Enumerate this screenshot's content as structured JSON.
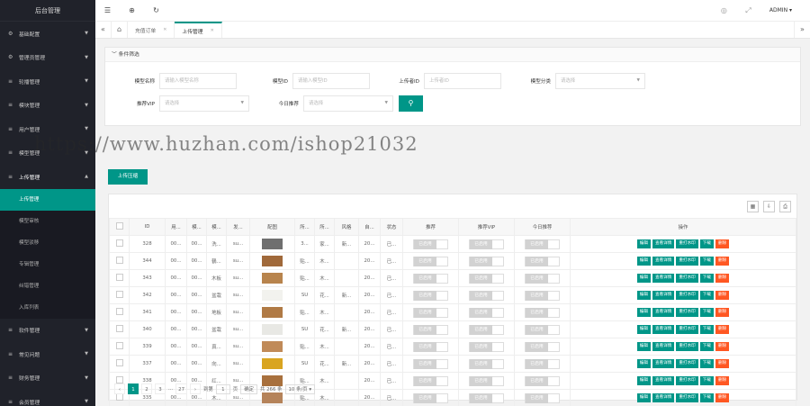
{
  "sidebar": {
    "logo": "后台管理",
    "items": [
      {
        "label": "基础配置",
        "icon": "gear-icon"
      },
      {
        "label": "管理员管理",
        "icon": "gear-icon"
      },
      {
        "label": "轮播管理",
        "icon": "menu-icon"
      },
      {
        "label": "模块管理",
        "icon": "menu-icon"
      },
      {
        "label": "用户管理",
        "icon": "menu-icon"
      },
      {
        "label": "模型管理",
        "icon": "menu-icon"
      },
      {
        "label": "上传管理",
        "icon": "menu-icon"
      }
    ],
    "subitems": [
      "上传管理",
      "模型审核",
      "模型驳移",
      "专辑管理",
      "纠错管理",
      "入库列表"
    ],
    "bottom_items": [
      {
        "label": "软件管理",
        "icon": "menu-icon"
      },
      {
        "label": "常见问题",
        "icon": "menu-icon"
      },
      {
        "label": "财务管理",
        "icon": "menu-icon"
      },
      {
        "label": "会员管理",
        "icon": "menu-icon"
      }
    ]
  },
  "topbar": {
    "user": "ADMIN"
  },
  "tabs": [
    {
      "label": "充值订单"
    },
    {
      "label": "上传管理"
    }
  ],
  "filter": {
    "title": "条件筛选",
    "fields": {
      "model_name": {
        "label": "模型名称",
        "placeholder": "请输入模型名称"
      },
      "model_id": {
        "label": "模型ID",
        "placeholder": "请输入模型ID"
      },
      "uploader_id": {
        "label": "上传者ID",
        "placeholder": "上传者ID"
      },
      "category": {
        "label": "模型分类",
        "placeholder": "请选择"
      },
      "vip": {
        "label": "推荐VIP",
        "placeholder": "请选择"
      },
      "today": {
        "label": "今日推荐",
        "placeholder": "请选择"
      }
    }
  },
  "upload_button": "上传压缩",
  "table": {
    "headers": [
      "ID",
      "用...",
      "模...",
      "模...",
      "发...",
      "配图",
      "所...",
      "所...",
      "风格",
      "自...",
      "状态",
      "推荐",
      "推荐VIP",
      "今日推荐",
      "操作"
    ],
    "switch_label": "已启用",
    "actions": [
      "编辑",
      "查看详情",
      "重打水印",
      "下载",
      "删除"
    ],
    "rows": [
      {
        "id": "328",
        "c1": "00...",
        "c2": "00...",
        "c3": "洗...",
        "c4": "su...",
        "thumb": "#6f6f6f",
        "c6": "3...",
        "c7": "家...",
        "c8": "新...",
        "c9": "20...",
        "c10": "已..."
      },
      {
        "id": "344",
        "c1": "00...",
        "c2": "00...",
        "c3": "鶴...",
        "c4": "su...",
        "thumb": "#a0693a",
        "c6": "贴...",
        "c7": "木...",
        "c8": "",
        "c9": "20...",
        "c10": "已..."
      },
      {
        "id": "343",
        "c1": "00...",
        "c2": "00...",
        "c3": "木板",
        "c4": "su...",
        "thumb": "#b8844d",
        "c6": "贴...",
        "c7": "木...",
        "c8": "",
        "c9": "20...",
        "c10": "已..."
      },
      {
        "id": "342",
        "c1": "00...",
        "c2": "00...",
        "c3": "盆栽",
        "c4": "su...",
        "thumb": "#f2f2ee",
        "c6": "SU",
        "c7": "花...",
        "c8": "新...",
        "c9": "20...",
        "c10": "已..."
      },
      {
        "id": "341",
        "c1": "00...",
        "c2": "00...",
        "c3": "地板",
        "c4": "su...",
        "thumb": "#b07a45",
        "c6": "贴...",
        "c7": "木...",
        "c8": "",
        "c9": "20...",
        "c10": "已..."
      },
      {
        "id": "340",
        "c1": "00...",
        "c2": "00...",
        "c3": "盆栽",
        "c4": "su...",
        "thumb": "#e8e8e4",
        "c6": "SU",
        "c7": "花...",
        "c8": "新...",
        "c9": "20...",
        "c10": "已..."
      },
      {
        "id": "339",
        "c1": "00...",
        "c2": "00...",
        "c3": "真...",
        "c4": "su...",
        "thumb": "#c08a58",
        "c6": "贴...",
        "c7": "木...",
        "c8": "",
        "c9": "20...",
        "c10": "已..."
      },
      {
        "id": "337",
        "c1": "00...",
        "c2": "00...",
        "c3": "向...",
        "c4": "su...",
        "thumb": "#d9a520",
        "c6": "SU",
        "c7": "花...",
        "c8": "新...",
        "c9": "20...",
        "c10": "已..."
      },
      {
        "id": "338",
        "c1": "00...",
        "c2": "00...",
        "c3": "红...",
        "c4": "su...",
        "thumb": "#a8703d",
        "c6": "贴...",
        "c7": "木...",
        "c8": "",
        "c9": "20...",
        "c10": "已..."
      },
      {
        "id": "335",
        "c1": "00...",
        "c2": "00...",
        "c3": "木...",
        "c4": "su...",
        "thumb": "#b5835a",
        "c6": "贴...",
        "c7": "木...",
        "c8": "",
        "c9": "20...",
        "c10": "已..."
      }
    ]
  },
  "pager": {
    "pages": [
      "1",
      "2",
      "3",
      "...",
      "27"
    ],
    "goto_label": "到第",
    "goto_value": "1",
    "page_unit": "页",
    "confirm": "确定",
    "total": "共 266 条",
    "per_page": "10 条/页"
  },
  "watermark": "https://www.huzhan.com/ishop21032",
  "colors": {
    "accent": "#009688",
    "danger": "#ff5722",
    "sidebar": "#20222a"
  }
}
